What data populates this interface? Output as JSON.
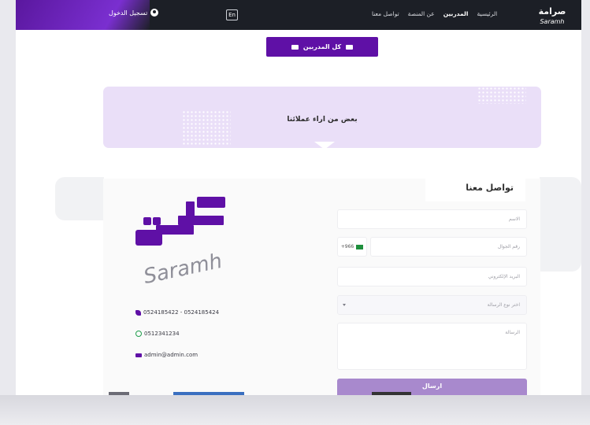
{
  "header": {
    "login_label": "تسجيل الدخول",
    "lang_label": "En",
    "menu": [
      "الرئيسية",
      "المدربين",
      "عن المنصة",
      "تواصل معنا"
    ]
  },
  "trainers_button_label": "كل المدربين",
  "testimonials": {
    "title": "بعض من اراء عملائنا"
  },
  "contact": {
    "title": "تواصل معنا",
    "name_placeholder": "الاسم",
    "phone_placeholder": "رقم الجوال",
    "phone_code": "+966",
    "email_placeholder": "البريد الإلكتروني",
    "message_type_placeholder": "اختر نوع الرسالة",
    "message_placeholder": "الرسالة",
    "send_label": "ارسال"
  },
  "info": {
    "phones": "0524185422 - 0524185424",
    "whatsapp": "0512341234",
    "email": "admin@admin.com"
  },
  "brand": {
    "latin": "Saramh",
    "arabic": "صرامة"
  },
  "colors": {
    "primary": "#5f10a6",
    "nav_bg": "#1c1f26",
    "testimonials_bg": "#eadff8",
    "send_btn": "#a889cd"
  }
}
